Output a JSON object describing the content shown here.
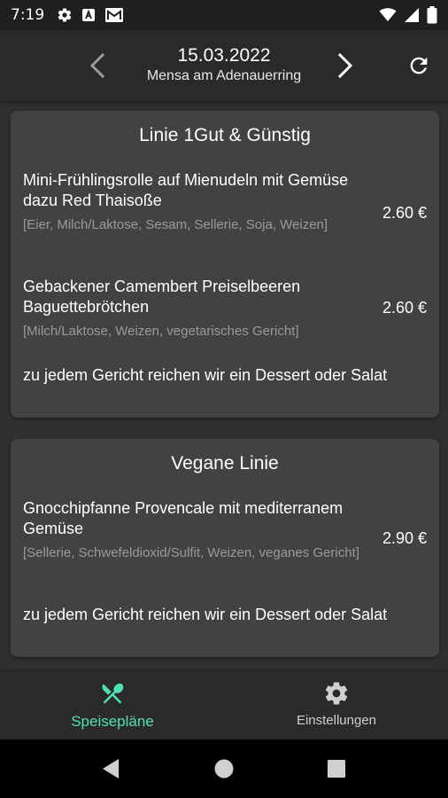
{
  "status_bar": {
    "time": "7:19",
    "left_icons": [
      "gear-icon",
      "a-box-icon",
      "gmail-icon"
    ],
    "right_icons": [
      "wifi-icon",
      "signal-icon",
      "battery-icon"
    ]
  },
  "toolbar": {
    "date": "15.03.2022",
    "mensa": "Mensa am Adenauerring",
    "prev_icon": "chevron-left-icon",
    "next_icon": "chevron-right-icon",
    "refresh_icon": "refresh-icon"
  },
  "cards": [
    {
      "title": "Linie 1Gut & Günstig",
      "meals": [
        {
          "name": "Mini-Frühlingsrolle auf Mienudeln mit Gemüse dazu Red Thaisoße",
          "allergens": "[Eier, Milch/Laktose, Sesam, Sellerie, Soja, Weizen]",
          "price": "2.60 €"
        },
        {
          "name": "Gebackener Camembert Preiselbeeren Baguettebrötchen",
          "allergens": "[Milch/Laktose, Weizen, vegetarisches Gericht]",
          "price": "2.60 €"
        }
      ],
      "note": "zu jedem Gericht reichen wir ein Dessert oder Salat"
    },
    {
      "title": "Vegane Linie",
      "meals": [
        {
          "name": "Gnocchipfanne Provencale mit mediterranem Gemüse",
          "allergens": "[Sellerie, Schwefeldioxid/Sulfit, Weizen, veganes Gericht]",
          "price": "2.90 €"
        }
      ],
      "note": "zu jedem Gericht reichen wir ein Dessert oder Salat"
    }
  ],
  "bottom_nav": {
    "tabs": [
      {
        "label": "Speisepläne",
        "icon": "cutlery-icon",
        "active": true
      },
      {
        "label": "Einstellungen",
        "icon": "gear-icon",
        "active": false
      }
    ]
  },
  "colors": {
    "accent": "#4fe0b5",
    "background": "#303030",
    "card": "#424242",
    "toolbar": "#2a2a2a"
  }
}
